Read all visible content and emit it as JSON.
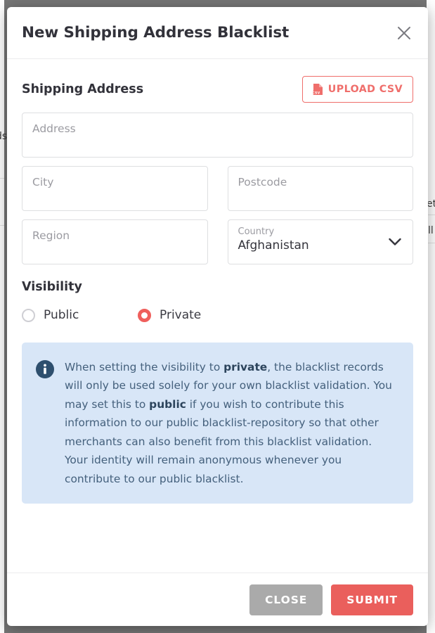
{
  "background": {
    "left_fragment": "ds",
    "right_fragment_top": "et",
    "right_fragment_bottom": "ll"
  },
  "dialog": {
    "title": "New Shipping Address Blacklist",
    "close_icon": "close-icon"
  },
  "shipping_section": {
    "title": "Shipping Address",
    "upload_button": {
      "label": "UPLOAD CSV",
      "icon": "csv-file-icon",
      "color": "#ef6e6b"
    }
  },
  "form": {
    "address": {
      "placeholder": "Address",
      "value": ""
    },
    "city": {
      "placeholder": "City",
      "value": ""
    },
    "postcode": {
      "placeholder": "Postcode",
      "value": ""
    },
    "region": {
      "placeholder": "Region",
      "value": ""
    },
    "country": {
      "label": "Country",
      "value": "Afghanistan",
      "icon": "chevron-down-icon"
    }
  },
  "visibility": {
    "title": "Visibility",
    "options": [
      {
        "label": "Public",
        "selected": false
      },
      {
        "label": "Private",
        "selected": true
      }
    ],
    "selected_color": "#ef5f5c"
  },
  "info": {
    "icon": "info-circle-icon",
    "background": "#d8e6f7",
    "parts": [
      {
        "text": "When setting the visibility to ",
        "bold": false
      },
      {
        "text": "private",
        "bold": true
      },
      {
        "text": ", the blacklist records will only be used solely for your own blacklist validation. You may set this to ",
        "bold": false
      },
      {
        "text": "public",
        "bold": true
      },
      {
        "text": " if you wish to contribute this information to our public blacklist-repository so that other merchants can also benefit from this blacklist validation. Your identity will remain anonymous whenever you contribute to our public blacklist.",
        "bold": false
      }
    ]
  },
  "footer": {
    "close_label": "CLOSE",
    "submit_label": "SUBMIT",
    "close_color": "#aaaaaa",
    "submit_color": "#ea5f5c"
  }
}
